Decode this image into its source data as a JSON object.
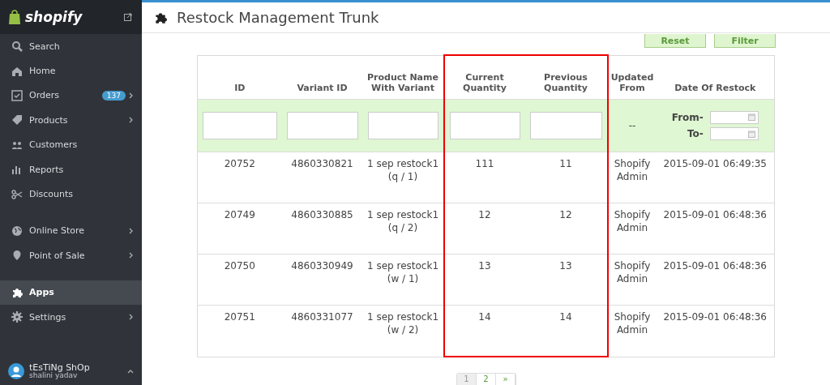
{
  "sidebar": {
    "brand": "shopify",
    "items": [
      {
        "label": "Search",
        "chevron": false,
        "selected": false
      },
      {
        "label": "Home",
        "chevron": false,
        "selected": false
      },
      {
        "label": "Orders",
        "badge": "137",
        "chevron": true,
        "selected": false
      },
      {
        "label": "Products",
        "chevron": true,
        "selected": false
      },
      {
        "label": "Customers",
        "chevron": false,
        "selected": false
      },
      {
        "label": "Reports",
        "chevron": false,
        "selected": false
      },
      {
        "label": "Discounts",
        "chevron": false,
        "selected": false
      },
      {
        "label": "Online Store",
        "chevron": true,
        "selected": false
      },
      {
        "label": "Point of Sale",
        "chevron": true,
        "selected": false
      },
      {
        "label": "Apps",
        "chevron": false,
        "selected": true
      },
      {
        "label": "Settings",
        "chevron": true,
        "selected": false
      }
    ],
    "account": {
      "store": "tEsTiNg ShOp",
      "user": "shalini yadav"
    }
  },
  "page": {
    "title": "Restock Management Trunk"
  },
  "actions": [
    "Reset",
    "Filter"
  ],
  "table": {
    "columns": [
      {
        "label": "ID",
        "highlighted": false
      },
      {
        "label": "Variant ID",
        "highlighted": false
      },
      {
        "label": "Product Name With Variant",
        "highlighted": false
      },
      {
        "label": "Current Quantity",
        "highlighted": true
      },
      {
        "label": "Previous Quantity",
        "highlighted": true
      },
      {
        "label": "Updated From",
        "highlighted": false
      },
      {
        "label": "Date Of Restock",
        "highlighted": false
      }
    ],
    "filter": {
      "updated_from": "--",
      "from_label": "From-",
      "to_label": "To-"
    },
    "rows": [
      [
        "20752",
        "4860330821",
        "1 sep restock1 (q / 1)",
        "111",
        "11",
        "Shopify Admin",
        "2015-09-01 06:49:35"
      ],
      [
        "20749",
        "4860330885",
        "1 sep restock1 (q / 2)",
        "12",
        "12",
        "Shopify Admin",
        "2015-09-01 06:48:36"
      ],
      [
        "20750",
        "4860330949",
        "1 sep restock1 (w / 1)",
        "13",
        "13",
        "Shopify Admin",
        "2015-09-01 06:48:36"
      ],
      [
        "20751",
        "4860331077",
        "1 sep restock1 (w / 2)",
        "14",
        "14",
        "Shopify Admin",
        "2015-09-01 06:48:36"
      ]
    ]
  },
  "pagination": [
    {
      "label": "1",
      "selected": true
    },
    {
      "label": "2",
      "selected": false
    },
    {
      "label": "»",
      "selected": false
    }
  ]
}
